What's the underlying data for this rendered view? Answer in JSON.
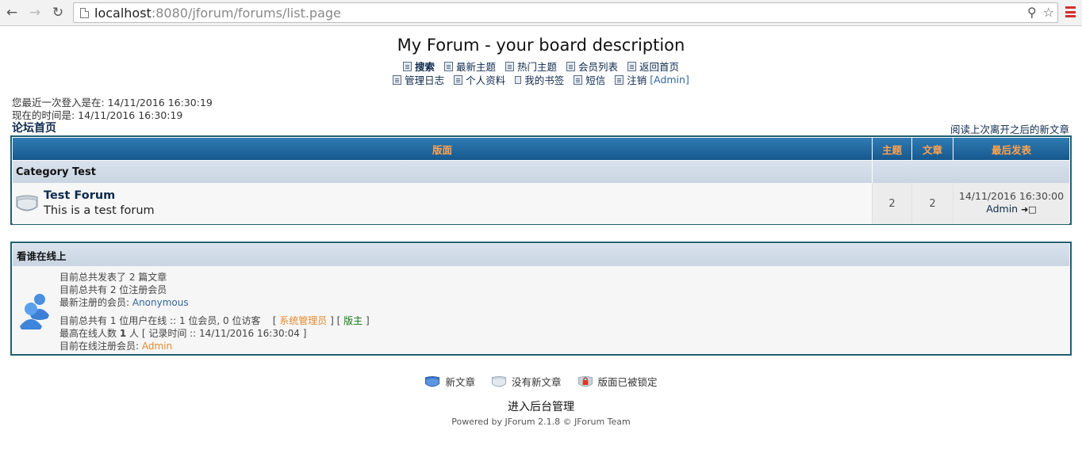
{
  "browser": {
    "url_host": "localhost",
    "url_rest": ":8080/jforum/forums/list.page"
  },
  "header": {
    "title": "My Forum - your board description",
    "nav_row1": [
      {
        "label": "搜索",
        "icon": "search-icon"
      },
      {
        "label": "最新主题",
        "icon": "recent-topics-icon"
      },
      {
        "label": "热门主题",
        "icon": "hot-topics-icon"
      },
      {
        "label": "会员列表",
        "icon": "member-list-icon"
      },
      {
        "label": "返回首页",
        "icon": "home-icon"
      }
    ],
    "nav_row2": [
      {
        "label": "管理日志",
        "icon": "moderation-log-icon"
      },
      {
        "label": "个人资料",
        "icon": "profile-icon"
      },
      {
        "label": "我的书签",
        "icon": "bookmark-icon"
      },
      {
        "label": "短信",
        "icon": "private-message-icon"
      },
      {
        "label": "注销",
        "icon": "logout-icon",
        "suffix": "[Admin]"
      }
    ]
  },
  "session": {
    "last_login": "您最近一次登入是在: 14/11/2016 16:30:19",
    "current_time": "现在的时间是: 14/11/2016 16:30:19"
  },
  "breadcrumb": {
    "home": "论坛首页",
    "unread": "阅读上次离开之后的新文章"
  },
  "forum_table": {
    "headers": {
      "forum": "版面",
      "topics": "主题",
      "posts": "文章",
      "last_post": "最后发表"
    },
    "category": "Category Test",
    "rows": [
      {
        "name": "Test Forum",
        "description": "This is a test forum",
        "topics": "2",
        "posts": "2",
        "last_post_time": "14/11/2016 16:30:00",
        "last_post_user": "Admin"
      }
    ]
  },
  "online": {
    "title": "看谁在线上",
    "total_posts": "目前总共发表了 2 篇文章",
    "total_users": "目前总共有 2 位注册会员",
    "newest_prefix": "最新注册的会员: ",
    "newest_user": "Anonymous",
    "online_now": "目前总共有 1 位用户在线 :: 1 位会员, 0 位访客",
    "legend_open": "[ ",
    "admin_role": "系统管理员",
    "legend_mid": " ] [ ",
    "moderator_role": "版主",
    "legend_close": " ]",
    "max_online_prefix": "最高在线人数 ",
    "max_online_count": "1",
    "max_online_suffix": " 人 [ 记录时间 :: 14/11/2016 16:30:04 ]",
    "registered_prefix": "目前在线注册会员: ",
    "registered_user": "Admin"
  },
  "legend": {
    "new_posts": "新文章",
    "no_new_posts": "没有新文章",
    "locked": "版面已被锁定"
  },
  "footer": {
    "admin_panel": "进入后台管理",
    "powered_by": "Powered by JForum 2.1.8 © JForum Team"
  },
  "colors": {
    "header_bar": "#17588e",
    "header_text": "#ffa34f",
    "border": "#206070",
    "admin_color": "#e58a2e",
    "moderator_color": "#117a11"
  }
}
